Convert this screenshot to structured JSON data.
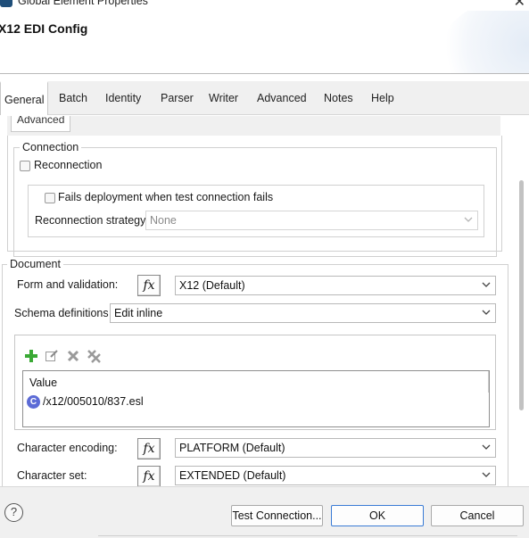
{
  "window": {
    "title": "Global Element Properties",
    "close_glyph": "✕"
  },
  "header": {
    "config_title": "X12 EDI Config"
  },
  "tabs": [
    {
      "label": "General",
      "active": true
    },
    {
      "label": "Batch"
    },
    {
      "label": "Identity"
    },
    {
      "label": "Parser"
    },
    {
      "label": "Writer"
    },
    {
      "label": "Advanced"
    },
    {
      "label": "Notes"
    },
    {
      "label": "Help"
    }
  ],
  "subtab": {
    "label": "Advanced"
  },
  "connection": {
    "legend": "Connection",
    "reconnection_label": "Reconnection",
    "fails_deployment_label": "Fails deployment when test connection fails",
    "strategy_label": "Reconnection strategy",
    "strategy_value": "None"
  },
  "document": {
    "legend": "Document",
    "form_label": "Form and validation:",
    "form_value": "X12 (Default)",
    "schema_label": "Schema definitions",
    "schema_value": "Edit inline",
    "table_header": "Value",
    "table_rows": [
      "/x12/005010/837.esl"
    ],
    "row_icon_letter": "C",
    "encoding_label": "Character encoding:",
    "encoding_value": "PLATFORM (Default)",
    "charset_label": "Character set:",
    "charset_value": "EXTENDED (Default)",
    "fx_label": "fx"
  },
  "footer": {
    "help_glyph": "?",
    "test_connection_label": "Test Connection...",
    "ok_label": "OK",
    "cancel_label": "Cancel"
  },
  "icons": {
    "add": "add-icon",
    "edit": "edit-icon",
    "delete": "delete-icon",
    "delete_all": "delete-all-icon",
    "app": "app-icon",
    "dropdown": "chevron-down-icon"
  },
  "colors": {
    "accent": "#3a7bd5",
    "add_green": "#3aa935",
    "row_icon": "#5c6bd6"
  }
}
